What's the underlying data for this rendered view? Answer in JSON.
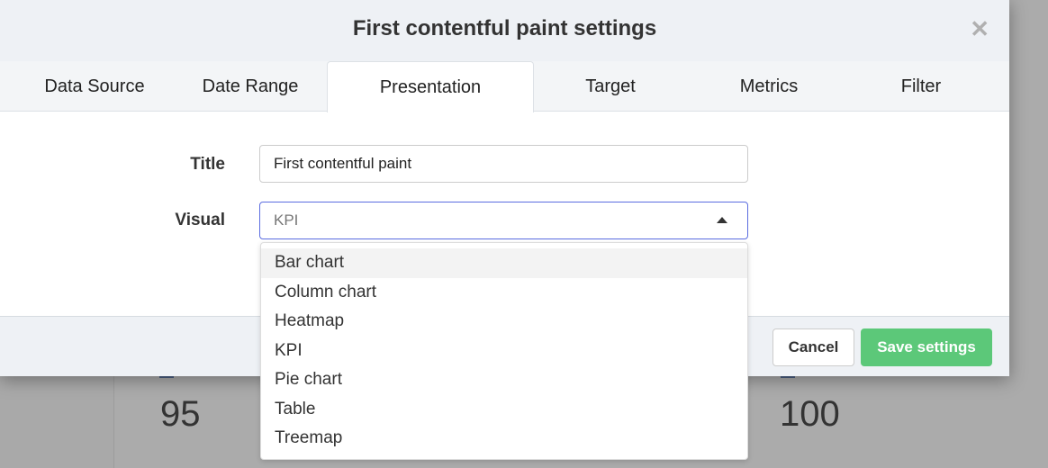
{
  "background": {
    "values": [
      "95",
      "100"
    ]
  },
  "modal": {
    "title": "First contentful paint settings",
    "close_icon": "close-icon",
    "tabs": [
      {
        "label": "Data Source"
      },
      {
        "label": "Date Range"
      },
      {
        "label": "Presentation",
        "active": true
      },
      {
        "label": "Target"
      },
      {
        "label": "Metrics"
      },
      {
        "label": "Filter"
      }
    ],
    "form": {
      "title_label": "Title",
      "title_value": "First contentful paint",
      "visual_label": "Visual",
      "visual_value": "KPI",
      "visual_options": [
        "Bar chart",
        "Column chart",
        "Heatmap",
        "KPI",
        "Pie chart",
        "Table",
        "Treemap"
      ],
      "highlighted_option": "Bar chart"
    },
    "footer": {
      "cancel_label": "Cancel",
      "save_label": "Save settings"
    }
  },
  "colors": {
    "accent": "#5b6de0",
    "save": "#5cc879"
  }
}
